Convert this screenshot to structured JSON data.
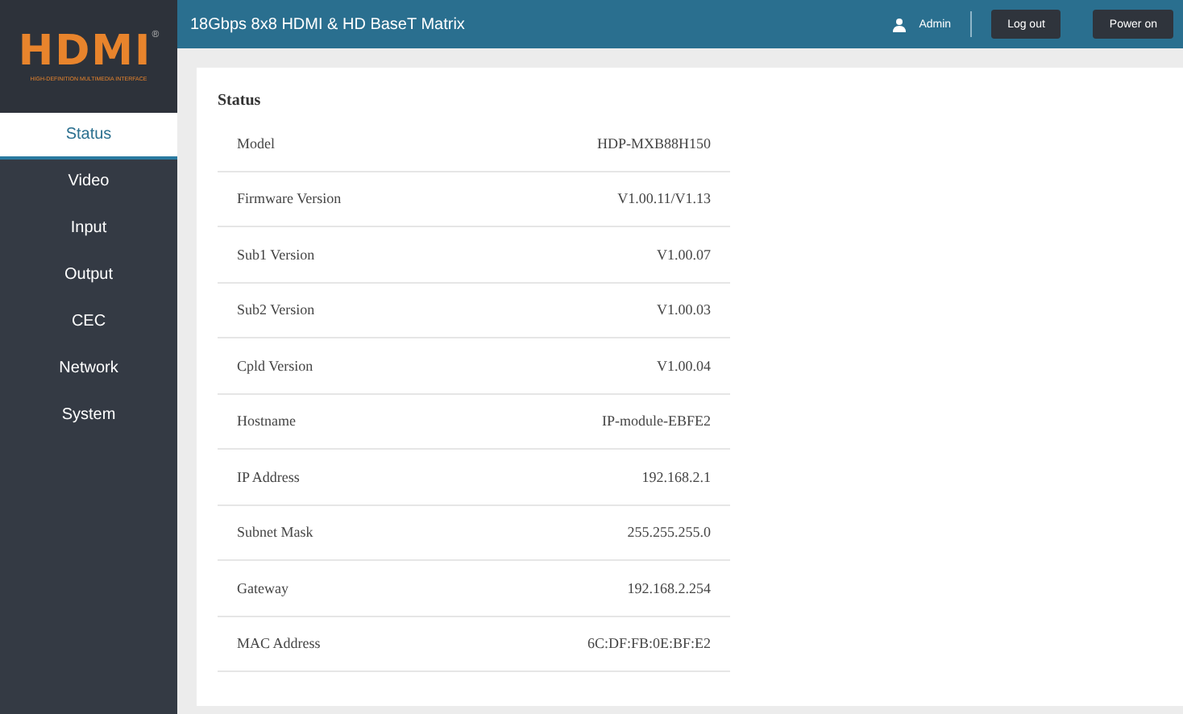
{
  "logo": {
    "text": "HDMI",
    "mark": "®",
    "tagline": "HIGH-DEFINITION MULTIMEDIA INTERFACE"
  },
  "header": {
    "title": "18Gbps 8x8 HDMI & HD BaseT Matrix",
    "user": "Admin",
    "buttons": [
      "Log out",
      "Power on"
    ]
  },
  "sidebar": {
    "items": [
      {
        "label": "Status",
        "selected": true
      },
      {
        "label": "Video",
        "selected": false
      },
      {
        "label": "Input",
        "selected": false
      },
      {
        "label": "Output",
        "selected": false
      },
      {
        "label": "CEC",
        "selected": false
      },
      {
        "label": "Network",
        "selected": false
      },
      {
        "label": "System",
        "selected": false
      }
    ]
  },
  "status": {
    "title": "Status",
    "rows": [
      {
        "label": "Model",
        "value": "HDP-MXB88H150"
      },
      {
        "label": "Firmware Version",
        "value": "V1.00.11/V1.13"
      },
      {
        "label": "Sub1 Version",
        "value": "V1.00.07"
      },
      {
        "label": "Sub2 Version",
        "value": "V1.00.03"
      },
      {
        "label": "Cpld Version",
        "value": "V1.00.04"
      },
      {
        "label": "Hostname",
        "value": "IP-module-EBFE2"
      },
      {
        "label": "IP Address",
        "value": "192.168.2.1"
      },
      {
        "label": "Subnet Mask",
        "value": "255.255.255.0"
      },
      {
        "label": "Gateway",
        "value": "192.168.2.254"
      },
      {
        "label": "MAC Address",
        "value": "6C:DF:FB:0E:BF:E2"
      }
    ]
  }
}
